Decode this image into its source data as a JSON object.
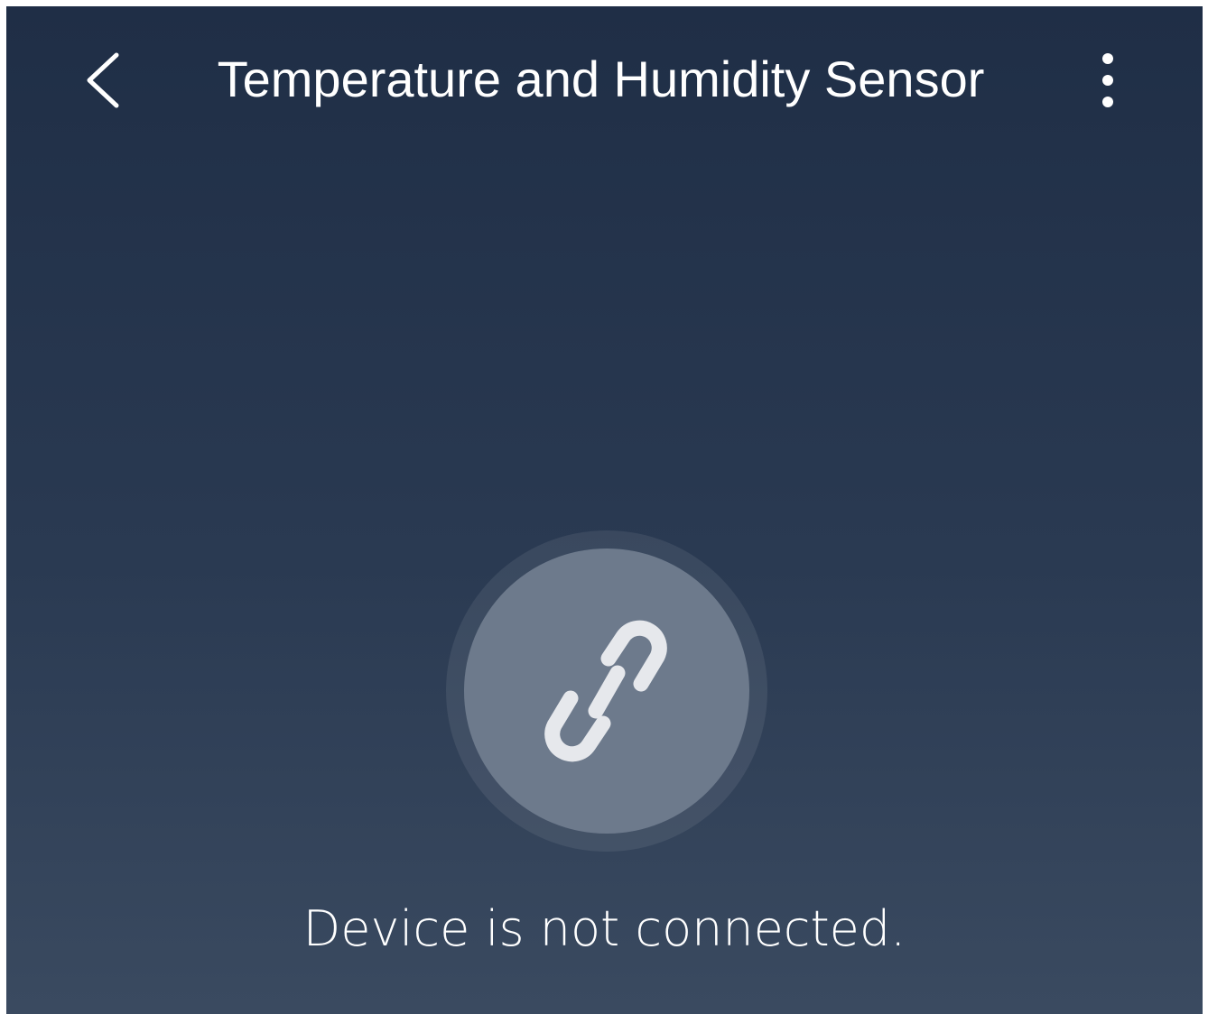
{
  "header": {
    "back_icon": "chevron-left-icon",
    "title": "Temperature and Humidity Sensor",
    "more_icon": "more-vertical-icon"
  },
  "status": {
    "icon": "link-icon",
    "message": "Device is not connected."
  },
  "colors": {
    "background_top": "#1f2e46",
    "background_bottom": "#3a4a60",
    "status_circle": "#6d7a8c",
    "icon": "#e6e8ec",
    "text": "#ffffff"
  }
}
